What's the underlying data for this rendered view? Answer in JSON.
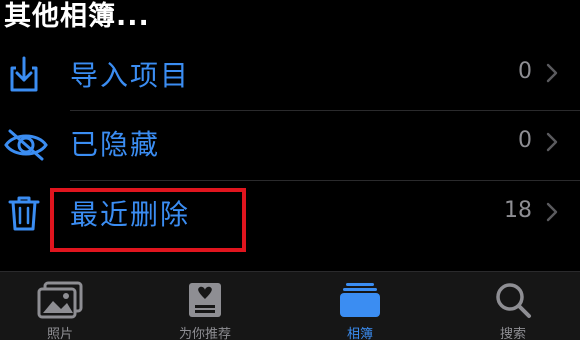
{
  "section": {
    "title": "其他相簿..."
  },
  "albums": [
    {
      "label": "导入项目",
      "count": "0",
      "icon": "import-icon"
    },
    {
      "label": "已隐藏",
      "count": "0",
      "icon": "hidden-eye-icon"
    },
    {
      "label": "最近删除",
      "count": "18",
      "icon": "trash-icon"
    }
  ],
  "tabbar": {
    "tabs": [
      {
        "label": "照片",
        "icon": "photos-icon",
        "active": false
      },
      {
        "label": "为你推荐",
        "icon": "for-you-icon",
        "active": false
      },
      {
        "label": "相簿",
        "icon": "albums-icon",
        "active": true
      },
      {
        "label": "搜索",
        "icon": "search-icon",
        "active": false
      }
    ]
  },
  "colors": {
    "accent": "#3b8df2",
    "count": "#8e8e93",
    "highlight": "#e0151e",
    "background": "#000000"
  }
}
